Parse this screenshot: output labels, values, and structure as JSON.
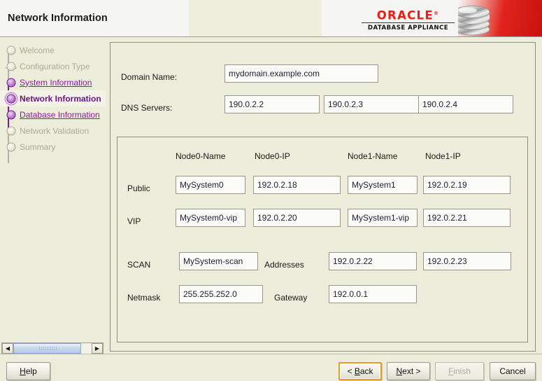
{
  "header": {
    "title": "Network Information",
    "brand": {
      "word": "ORACLE",
      "registered": "®",
      "sub": "DATABASE APPLIANCE",
      "disk_icon": "database-cylinder-icon",
      "accent_color": "#ee1c12"
    }
  },
  "sidebar": {
    "items": [
      {
        "label": "Welcome",
        "state": "disabled",
        "marker": "grey"
      },
      {
        "label": "Configuration Type",
        "state": "disabled",
        "marker": "grey-branch"
      },
      {
        "label": "System Information",
        "state": "link",
        "marker": "purple"
      },
      {
        "label": "Network Information",
        "state": "current",
        "marker": "current"
      },
      {
        "label": "Database Information",
        "state": "link",
        "marker": "purple"
      },
      {
        "label": "Network Validation",
        "state": "disabled",
        "marker": "grey"
      },
      {
        "label": "Summary",
        "state": "disabled",
        "marker": "grey"
      }
    ],
    "scrollbar": {
      "left_arrow": "◀",
      "right_arrow": "▶",
      "thumb_position_pct": 0
    }
  },
  "main": {
    "domain": {
      "label": "Domain Name:",
      "value": "mydomain.example.com"
    },
    "dns": {
      "label": "DNS Servers:",
      "values": [
        "190.0.2.2",
        "190.0.2.3",
        "190.0.2.4"
      ]
    },
    "table": {
      "column_headers": [
        "Node0-Name",
        "Node0-IP",
        "Node1-Name",
        "Node1-IP"
      ],
      "rows": [
        {
          "label": "Public",
          "values": [
            "MySystem0",
            "192.0.2.18",
            "MySystem1",
            "192.0.2.19"
          ]
        },
        {
          "label": "VIP",
          "values": [
            "MySystem0-vip",
            "192.0.2.20",
            "MySystem1-vip",
            "192.0.2.21"
          ]
        }
      ],
      "scan": {
        "label": "SCAN",
        "name_value": "MySystem-scan",
        "addresses_label": "Addresses",
        "addresses": [
          "192.0.2.22",
          "192.0.2.23"
        ]
      },
      "netmask": {
        "label": "Netmask",
        "value": "255.255.252.0",
        "gateway_label": "Gateway",
        "gateway_value": "192.0.0.1"
      }
    }
  },
  "buttons": {
    "help": {
      "pre": "",
      "mn": "H",
      "post": "elp"
    },
    "back": {
      "pre": "< ",
      "mn": "B",
      "post": "ack"
    },
    "next": {
      "pre": "",
      "mn": "N",
      "post": "ext >"
    },
    "finish": {
      "pre": "",
      "mn": "F",
      "post": "inish"
    },
    "cancel": {
      "pre": "Cancel",
      "mn": "",
      "post": ""
    }
  }
}
